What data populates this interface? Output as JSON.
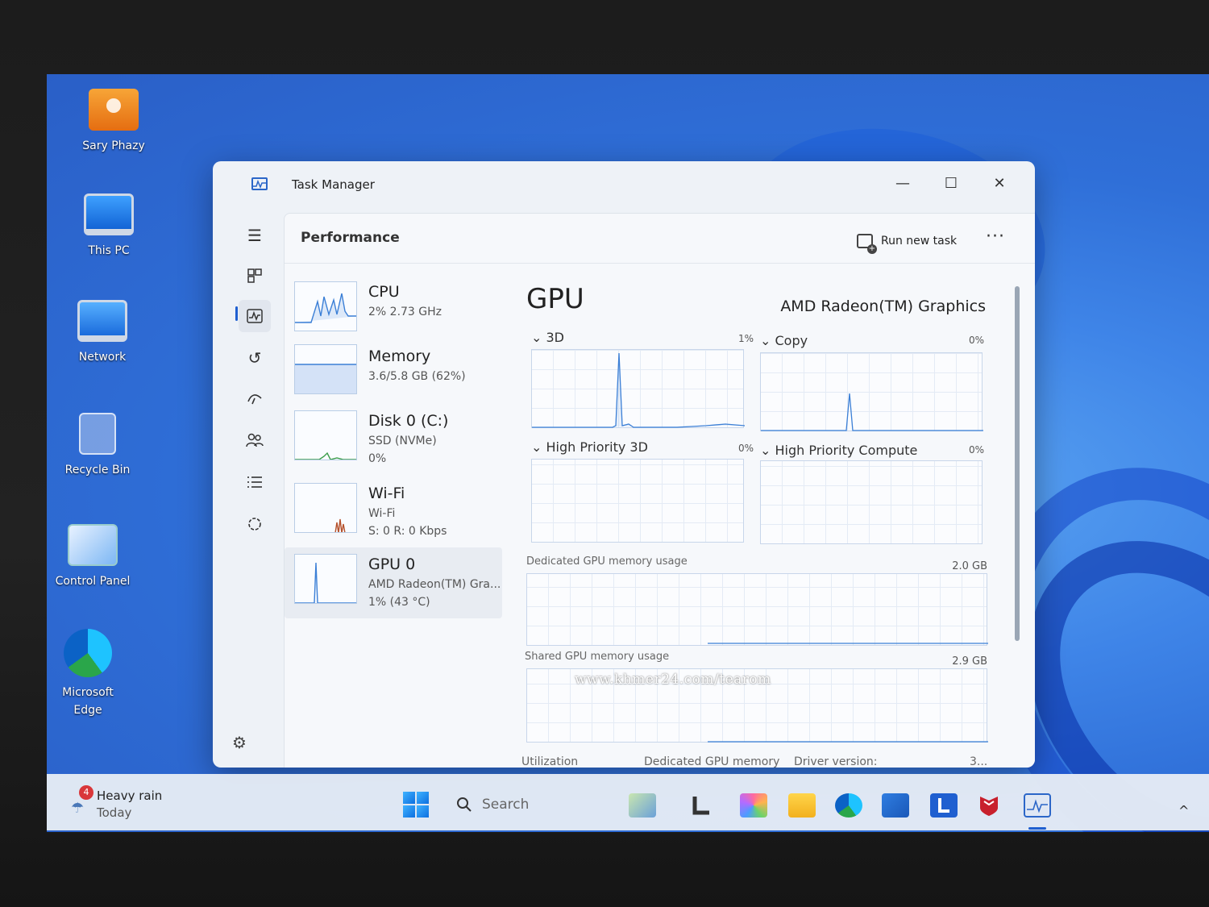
{
  "desktop": {
    "icons": [
      {
        "label": "Sary Phazy"
      },
      {
        "label": "This PC"
      },
      {
        "label": "Network"
      },
      {
        "label": "Recycle Bin"
      },
      {
        "label": "Control Panel"
      },
      {
        "label": "Microsoft Edge"
      }
    ]
  },
  "window": {
    "title": "Task Manager",
    "controls": {
      "minimize": "—",
      "maximize": "☐",
      "close": "✕"
    }
  },
  "header": {
    "page_title": "Performance",
    "run_new_task": "Run new task",
    "more": "···"
  },
  "resources": [
    {
      "name": "CPU",
      "line1": "2%  2.73 GHz",
      "line2": ""
    },
    {
      "name": "Memory",
      "line1": "3.6/5.8 GB (62%)",
      "line2": ""
    },
    {
      "name": "Disk 0 (C:)",
      "line1": "SSD (NVMe)",
      "line2": "0%"
    },
    {
      "name": "Wi-Fi",
      "line1": "Wi-Fi",
      "line2": "S: 0  R: 0 Kbps"
    },
    {
      "name": "GPU 0",
      "line1": "AMD Radeon(TM) Gra...",
      "line2": "1%  (43 °C)"
    }
  ],
  "gpu": {
    "title": "GPU",
    "model": "AMD Radeon(TM) Graphics",
    "engines": [
      {
        "label": "3D",
        "pct": "1%"
      },
      {
        "label": "Copy",
        "pct": "0%"
      },
      {
        "label": "High Priority 3D",
        "pct": "0%"
      },
      {
        "label": "High Priority Compute",
        "pct": "0%"
      }
    ],
    "dedicated_label": "Dedicated GPU memory usage",
    "dedicated_value": "2.0 GB",
    "shared_label": "Shared GPU memory usage",
    "shared_value": "2.9 GB",
    "bottom": {
      "utilization": "Utilization",
      "dedicated_memory": "Dedicated GPU memory",
      "driver_version": "Driver version:",
      "driver_value": "3..."
    }
  },
  "watermark": "www.khmer24.com/tearom",
  "taskbar": {
    "weather_badge": "4",
    "weather_condition": "Heavy rain",
    "weather_day": "Today",
    "search_placeholder": "Search",
    "tray_arrow": "^"
  },
  "colors": {
    "accent": "#1f5fd0",
    "desktop": "#3f85e8",
    "graph_line": "#3b7fd6"
  },
  "icons": [
    "menu-icon",
    "processes-icon",
    "performance-icon",
    "app-history-icon",
    "startup-apps-icon",
    "users-icon",
    "details-icon",
    "services-icon",
    "settings-icon"
  ]
}
